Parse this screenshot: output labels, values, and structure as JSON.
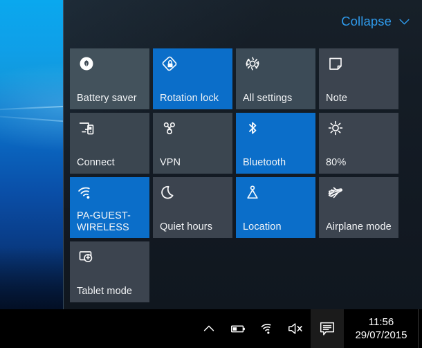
{
  "panel": {
    "collapse_label": "Collapse",
    "collapse_icon": "chevron-down-icon",
    "accent_color": "#0b6ec9",
    "link_color": "#2f9bec",
    "background_color": "#141c25",
    "tile_inactive_color": "#3c444f"
  },
  "tiles": [
    {
      "id": "battery-saver",
      "label": "Battery saver",
      "icon": "battery-saver-icon",
      "active": false,
      "translucent": true,
      "shade": "t-a"
    },
    {
      "id": "rotation-lock",
      "label": "Rotation lock",
      "icon": "rotation-lock-icon",
      "active": true,
      "translucent": false,
      "shade": ""
    },
    {
      "id": "all-settings",
      "label": "All settings",
      "icon": "gear-icon",
      "active": false,
      "translucent": true,
      "shade": "t-b"
    },
    {
      "id": "note",
      "label": "Note",
      "icon": "note-icon",
      "active": false,
      "translucent": false,
      "shade": ""
    },
    {
      "id": "connect",
      "label": "Connect",
      "icon": "connect-icon",
      "active": false,
      "translucent": true,
      "shade": "t-c"
    },
    {
      "id": "vpn",
      "label": "VPN",
      "icon": "vpn-icon",
      "active": false,
      "translucent": true,
      "shade": "t-c"
    },
    {
      "id": "bluetooth",
      "label": "Bluetooth",
      "icon": "bluetooth-icon",
      "active": true,
      "translucent": false,
      "shade": ""
    },
    {
      "id": "brightness",
      "label": "80%",
      "icon": "brightness-icon",
      "active": false,
      "translucent": false,
      "shade": ""
    },
    {
      "id": "wifi",
      "label": "PA-GUEST-WIRELESS",
      "icon": "wifi-icon",
      "active": true,
      "translucent": false,
      "shade": ""
    },
    {
      "id": "quiet-hours",
      "label": "Quiet hours",
      "icon": "moon-icon",
      "active": false,
      "translucent": false,
      "shade": ""
    },
    {
      "id": "location",
      "label": "Location",
      "icon": "location-icon",
      "active": true,
      "translucent": false,
      "shade": ""
    },
    {
      "id": "airplane-mode",
      "label": "Airplane mode",
      "icon": "airplane-icon",
      "active": false,
      "translucent": false,
      "shade": ""
    },
    {
      "id": "tablet-mode",
      "label": "Tablet mode",
      "icon": "tablet-mode-icon",
      "active": false,
      "translucent": false,
      "shade": ""
    }
  ],
  "taskbar": {
    "tray_icons": [
      {
        "id": "show-hidden-icons",
        "icon": "chevron-up-icon"
      },
      {
        "id": "battery",
        "icon": "battery-icon"
      },
      {
        "id": "network",
        "icon": "wifi-icon"
      },
      {
        "id": "volume",
        "icon": "speaker-muted-icon"
      }
    ],
    "action_center_icon": "action-center-icon",
    "clock": {
      "time": "11:56",
      "date": "29/07/2015"
    }
  }
}
